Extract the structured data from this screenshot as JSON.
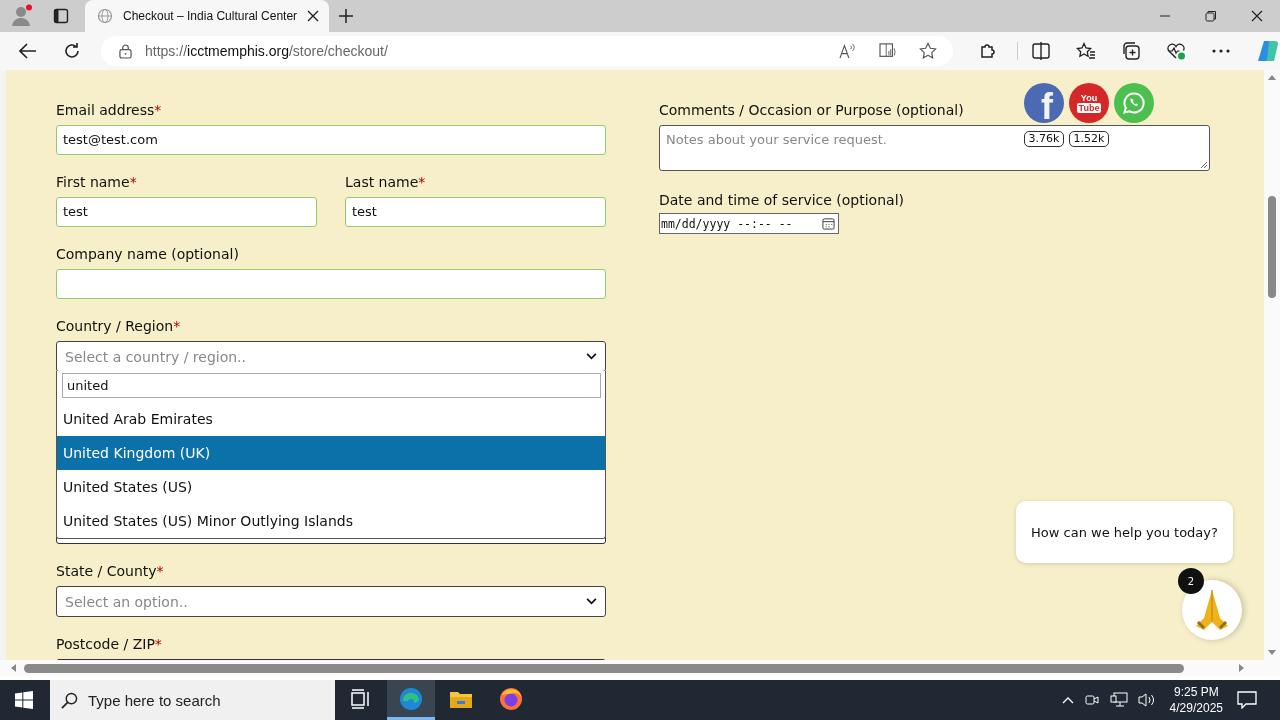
{
  "browser": {
    "tabs": [
      {
        "title": "Checkout – India Cultural Center",
        "selected": true
      }
    ],
    "url_parts": [
      {
        "text": "https://",
        "kind": "muted"
      },
      {
        "text": "icctmemphis.org",
        "kind": "host"
      },
      {
        "text": "/store/checkout/",
        "kind": "muted"
      }
    ]
  },
  "form": {
    "rows": [
      [
        {
          "kind": "input",
          "label": "Email address",
          "required_mark": "*",
          "value": "test@test.com",
          "valid": true
        }
      ],
      [
        {
          "kind": "input",
          "label": "First name",
          "required_mark": "*",
          "value": "test",
          "valid": true
        },
        {
          "kind": "input",
          "label": "Last name",
          "required_mark": "*",
          "value": "test",
          "valid": true
        }
      ],
      [
        {
          "kind": "input",
          "label": "Company name (optional)",
          "valid": true
        }
      ],
      [
        {
          "kind": "select",
          "label": "Country / Region",
          "required_mark": "*",
          "placeholder": "Select a country / region..",
          "dropdown": {
            "search": "united",
            "options": [
              {
                "label": "United Arab Emirates",
                "selected": false
              },
              {
                "label": "United Kingdom (UK)",
                "selected": true
              },
              {
                "label": "United States (US)",
                "selected": false
              },
              {
                "label": "United States (US) Minor Outlying Islands",
                "selected": false
              }
            ]
          }
        }
      ],
      [
        {
          "kind": "input",
          "valid": false
        }
      ],
      [
        {
          "kind": "select",
          "label": "State / County",
          "required_mark": "*",
          "placeholder": "Select an option.."
        }
      ],
      [
        {
          "kind": "input",
          "label": "Postcode / ZIP",
          "required_mark": "*"
        }
      ]
    ],
    "comments": {
      "label": "Comments / Occasion or Purpose (optional)",
      "placeholder": "Notes about your service request."
    },
    "service_date": {
      "label": "Date and time of service (optional)",
      "placeholder": "mm/dd/yyyy --:-- --"
    }
  },
  "social": [
    {
      "kind": "facebook",
      "glyph": "f",
      "count": "3.76k"
    },
    {
      "kind": "youtube",
      "glyph_lines": [
        "You",
        "Tube"
      ],
      "count": "1.52k"
    },
    {
      "kind": "whatsapp"
    }
  ],
  "chat": {
    "message": "How can we help you today?",
    "badge": "2"
  },
  "taskbar": {
    "search_placeholder": "Type here to search",
    "apps": [
      {
        "kind": "taskview",
        "selected": false
      },
      {
        "kind": "edge",
        "selected": true
      },
      {
        "kind": "files",
        "selected": false
      },
      {
        "kind": "firefox",
        "selected": false
      }
    ],
    "time": "9:25 PM",
    "date": "4/29/2025"
  }
}
